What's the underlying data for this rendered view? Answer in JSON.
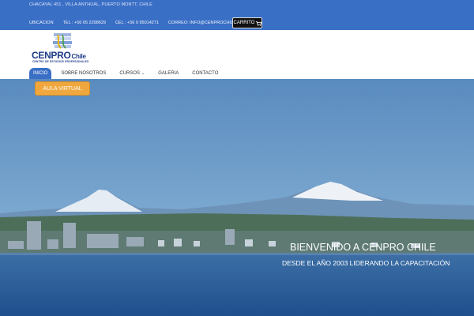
{
  "topbar": {
    "address": "Chacayal 451 , Villa Anthual, Puerto Montt, Chile",
    "contacts": [
      {
        "label": "UBICACION"
      },
      {
        "label": "TEL : +56 65 2298629"
      },
      {
        "label": "CEL : +56 9 95014271"
      },
      {
        "label": "CORREO: INFO@CENPROCHILE.CL"
      }
    ],
    "cart_label": "CARRITO",
    "cart_icon": "cart-icon"
  },
  "logo": {
    "main": "CENPRO",
    "accent": "Chile",
    "subtitle": "CENTRO DE ESTUDIOS PROFESIONALES"
  },
  "nav": {
    "items": [
      {
        "label": "INICIO",
        "active": true
      },
      {
        "label": "SOBRE NOSOTROS"
      },
      {
        "label": "CURSOS",
        "has_dropdown": true
      },
      {
        "label": "GALERIA"
      },
      {
        "label": "CONTACTO"
      }
    ]
  },
  "hero": {
    "button_label": "AULA VIRTUAL",
    "title": "BIENVENIDO A CENPRO CHILE",
    "subtitle": "DESDE EL AÑO 2003 LIDERANDO LA CAPACITACIÓN"
  },
  "colors": {
    "topbar": "#3a6fc6",
    "nav_active": "#3a6fc6",
    "aula_button": "#f0a83e",
    "logo_blue": "#1e3b8a"
  }
}
